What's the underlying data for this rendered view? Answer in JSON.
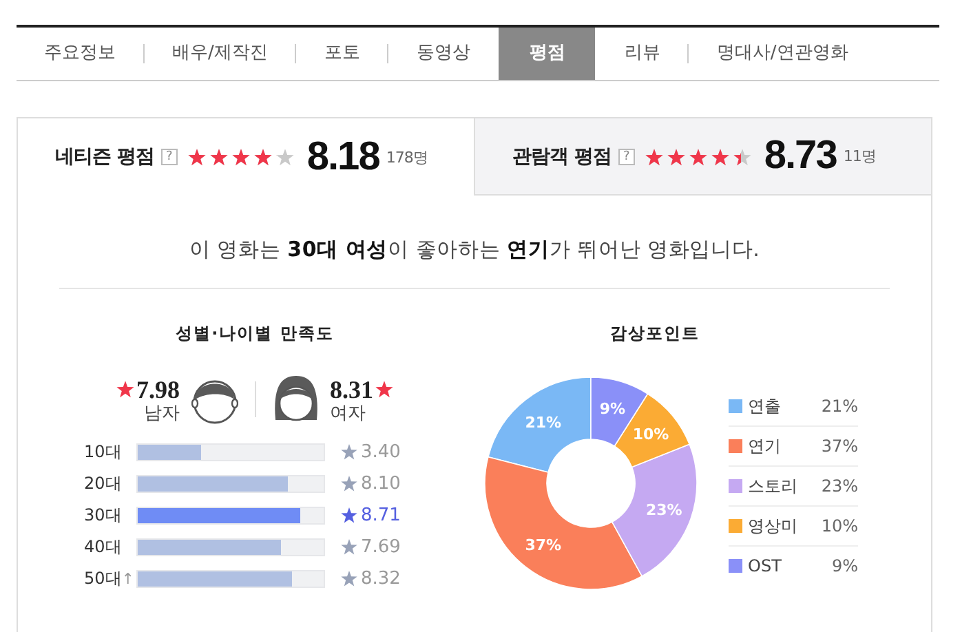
{
  "tabs": [
    {
      "label": "주요정보",
      "selected": false
    },
    {
      "label": "배우/제작진",
      "selected": false
    },
    {
      "label": "포토",
      "selected": false
    },
    {
      "label": "동영상",
      "selected": false
    },
    {
      "label": "평점",
      "selected": true
    },
    {
      "label": "리뷰",
      "selected": false
    },
    {
      "label": "명대사/연관영화",
      "selected": false
    }
  ],
  "rating_tabs": [
    {
      "label": "네티즌 평점",
      "help": "?",
      "level": 0.818,
      "score": "8.18",
      "count": "178명",
      "selected": true
    },
    {
      "label": "관람객 평점",
      "help": "?",
      "level": 0.873,
      "score": "8.73",
      "count": "11명",
      "selected": false
    }
  ],
  "summary": "이 영화는 **30대 여성**이 좋아하는 **연기**가 뛰어난 영화입니다.",
  "demographics": {
    "title": "성별·나이별 만족도",
    "genders": [
      {
        "kind": "male",
        "score": "7.98",
        "label": "남자"
      },
      {
        "kind": "female",
        "score": "8.31",
        "label": "여자"
      }
    ],
    "ages": [
      {
        "label": "10대",
        "level": 0.34,
        "score": "3.40",
        "highlighted": false
      },
      {
        "label": "20대",
        "level": 0.81,
        "score": "8.10",
        "highlighted": false
      },
      {
        "label": "30대",
        "level": 0.871,
        "score": "8.71",
        "highlighted": true
      },
      {
        "label": "40대",
        "level": 0.769,
        "score": "7.69",
        "highlighted": false
      },
      {
        "label": "50대",
        "suffix": "↑",
        "level": 0.832,
        "score": "8.32",
        "highlighted": false
      }
    ]
  },
  "points": {
    "title": "감상포인트",
    "chart_data": {
      "type": "donut",
      "categories": [
        "연출",
        "연기",
        "스토리",
        "영상미",
        "OST"
      ],
      "values": [
        21,
        37,
        23,
        10,
        9
      ],
      "data_labels": true,
      "value_labels": [
        "21%",
        "37%",
        "23%",
        "10%",
        "9%"
      ]
    },
    "legend": [
      {
        "value": "21%",
        "color": "#7ab8f5"
      },
      {
        "value": "37%",
        "color": "#fa7f5a"
      },
      {
        "value": "23%",
        "color": "#c5a9f2"
      },
      {
        "value": "10%",
        "color": "#fbab34"
      },
      {
        "value": "9%",
        "color": "#8a90f8"
      }
    ]
  }
}
